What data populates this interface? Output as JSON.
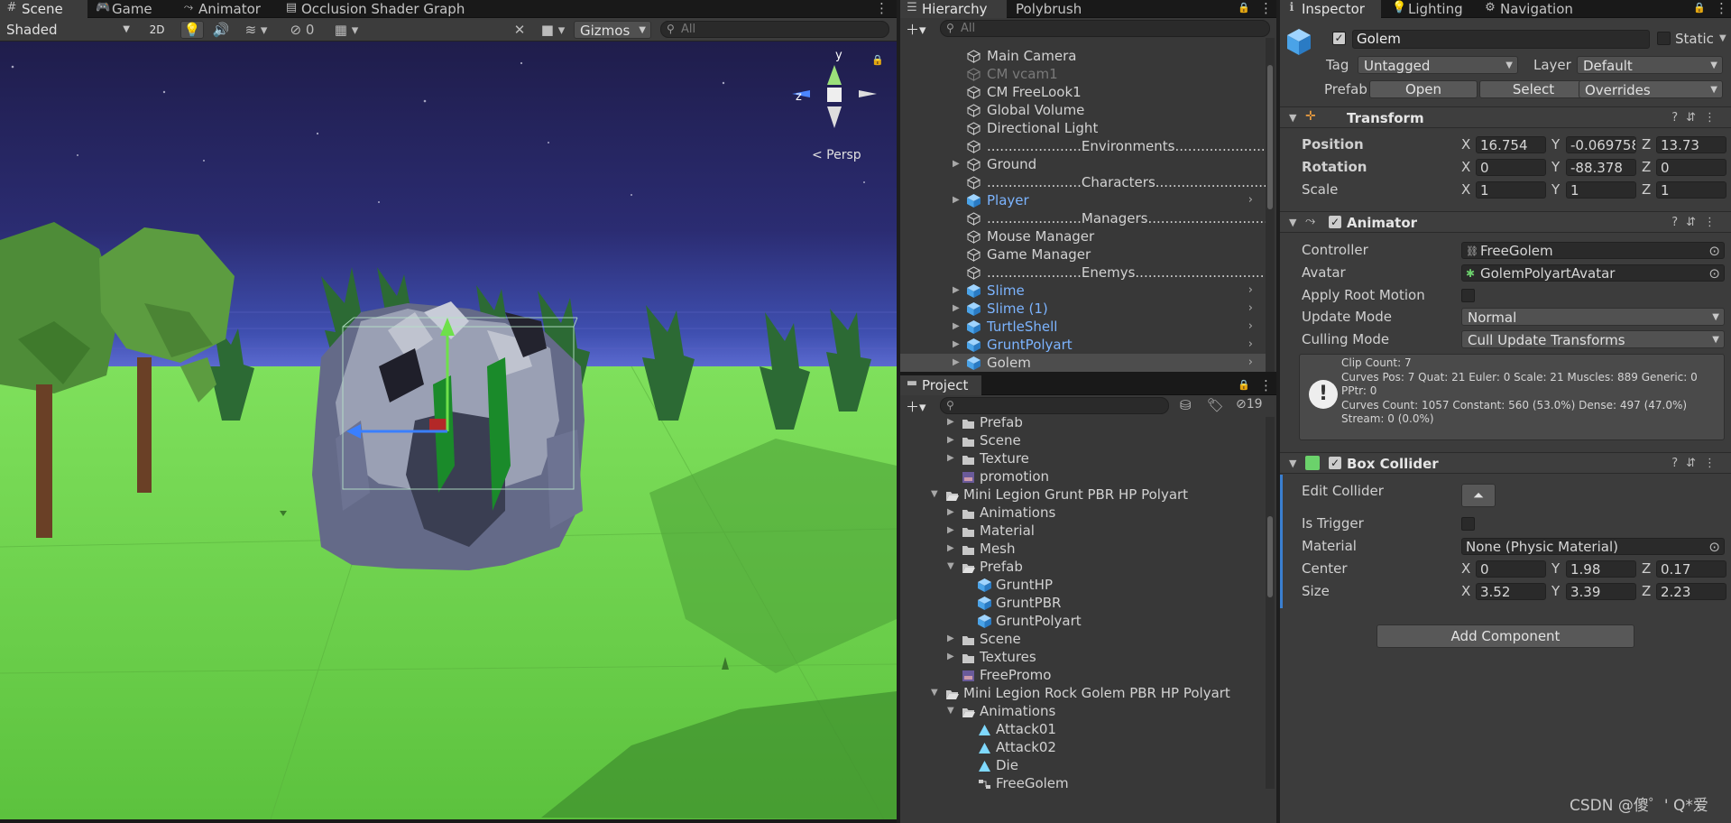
{
  "scene_panel": {
    "tabs": [
      {
        "label": "Scene",
        "icon": "hash-icon"
      },
      {
        "label": "Game",
        "icon": "gamepad-icon"
      },
      {
        "label": "Animator",
        "icon": "animator-icon"
      },
      {
        "label": "Occlusion Shader Graph",
        "icon": "shader-graph-icon"
      }
    ],
    "shading_mode": "Shaded",
    "mode_2d": "2D",
    "hidden_count": "0",
    "gizmos_label": "Gizmos",
    "search_placeholder": "All",
    "view_label": "< Persp",
    "axis_y": "y",
    "axis_z": "z"
  },
  "hierarchy": {
    "tabs": [
      "Hierarchy",
      "Polybrush"
    ],
    "search_placeholder": "All",
    "items": [
      {
        "label": "Main Camera",
        "style": "normal",
        "fold": "",
        "icon": "gameobject-icon"
      },
      {
        "label": "CM vcam1",
        "style": "dim",
        "fold": "",
        "icon": "gameobject-icon"
      },
      {
        "label": "CM FreeLook1",
        "style": "normal",
        "fold": "",
        "icon": "gameobject-icon"
      },
      {
        "label": "Global Volume",
        "style": "normal",
        "fold": "",
        "icon": "gameobject-icon"
      },
      {
        "label": "Directional Light",
        "style": "normal",
        "fold": "",
        "icon": "gameobject-icon"
      },
      {
        "label": "......................Environments..............................",
        "style": "normal",
        "fold": "",
        "icon": "gameobject-icon"
      },
      {
        "label": "Ground",
        "style": "normal",
        "fold": "▶",
        "icon": "gameobject-icon"
      },
      {
        "label": "......................Characters..............................",
        "style": "normal",
        "fold": "",
        "icon": "gameobject-icon"
      },
      {
        "label": "Player",
        "style": "prefab",
        "fold": "▶",
        "icon": "prefab-icon"
      },
      {
        "label": "......................Managers...............................",
        "style": "normal",
        "fold": "",
        "icon": "gameobject-icon"
      },
      {
        "label": "Mouse Manager",
        "style": "normal",
        "fold": "",
        "icon": "gameobject-icon"
      },
      {
        "label": "Game Manager",
        "style": "normal",
        "fold": "",
        "icon": "gameobject-icon"
      },
      {
        "label": "......................Enemys..............................",
        "style": "normal",
        "fold": "",
        "icon": "gameobject-icon"
      },
      {
        "label": "Slime",
        "style": "prefab",
        "fold": "▶",
        "icon": "prefab-icon"
      },
      {
        "label": "Slime (1)",
        "style": "prefab",
        "fold": "▶",
        "icon": "prefab-icon"
      },
      {
        "label": "TurtleShell",
        "style": "prefab",
        "fold": "▶",
        "icon": "prefab-icon"
      },
      {
        "label": "GruntPolyart",
        "style": "prefab",
        "fold": "▶",
        "icon": "prefab-icon"
      },
      {
        "label": "Golem",
        "style": "selected",
        "fold": "▶",
        "icon": "prefab-icon"
      }
    ]
  },
  "project": {
    "tab": "Project",
    "hidden_count": "19",
    "items": [
      {
        "label": "Prefab",
        "indent": 2,
        "fold": "▶",
        "icon": "folder-icon"
      },
      {
        "label": "Scene",
        "indent": 2,
        "fold": "▶",
        "icon": "folder-icon"
      },
      {
        "label": "Texture",
        "indent": 2,
        "fold": "▶",
        "icon": "folder-icon"
      },
      {
        "label": "promotion",
        "indent": 2,
        "fold": "",
        "icon": "image-icon"
      },
      {
        "label": "Mini Legion Grunt PBR HP Polyart",
        "indent": 1,
        "fold": "▼",
        "icon": "folder-open-icon"
      },
      {
        "label": "Animations",
        "indent": 2,
        "fold": "▶",
        "icon": "folder-icon"
      },
      {
        "label": "Material",
        "indent": 2,
        "fold": "▶",
        "icon": "folder-icon"
      },
      {
        "label": "Mesh",
        "indent": 2,
        "fold": "▶",
        "icon": "folder-icon"
      },
      {
        "label": "Prefab",
        "indent": 2,
        "fold": "▼",
        "icon": "folder-open-icon"
      },
      {
        "label": "GruntHP",
        "indent": 3,
        "fold": "",
        "icon": "prefab-icon"
      },
      {
        "label": "GruntPBR",
        "indent": 3,
        "fold": "",
        "icon": "prefab-icon"
      },
      {
        "label": "GruntPolyart",
        "indent": 3,
        "fold": "",
        "icon": "prefab-icon"
      },
      {
        "label": "Scene",
        "indent": 2,
        "fold": "▶",
        "icon": "folder-icon"
      },
      {
        "label": "Textures",
        "indent": 2,
        "fold": "▶",
        "icon": "folder-icon"
      },
      {
        "label": "FreePromo",
        "indent": 2,
        "fold": "",
        "icon": "image-icon"
      },
      {
        "label": "Mini Legion Rock Golem PBR HP Polyart",
        "indent": 1,
        "fold": "▼",
        "icon": "folder-open-icon"
      },
      {
        "label": "Animations",
        "indent": 2,
        "fold": "▼",
        "icon": "folder-open-icon"
      },
      {
        "label": "Attack01",
        "indent": 3,
        "fold": "",
        "icon": "anim-clip-icon"
      },
      {
        "label": "Attack02",
        "indent": 3,
        "fold": "",
        "icon": "anim-clip-icon"
      },
      {
        "label": "Die",
        "indent": 3,
        "fold": "",
        "icon": "anim-clip-icon"
      },
      {
        "label": "FreeGolem",
        "indent": 3,
        "fold": "",
        "icon": "animator-controller-icon"
      }
    ]
  },
  "inspector": {
    "tabs": [
      "Inspector",
      "Lighting",
      "Navigation"
    ],
    "object_name": "Golem",
    "static_label": "Static",
    "tag_label": "Tag",
    "tag_value": "Untagged",
    "layer_label": "Layer",
    "layer_value": "Default",
    "prefab_label": "Prefab",
    "open_label": "Open",
    "select_label": "Select",
    "overrides_label": "Overrides",
    "transform": {
      "title": "Transform",
      "position_label": "Position",
      "rotation_label": "Rotation",
      "scale_label": "Scale",
      "position": {
        "x": "16.754",
        "y": "-0.069758",
        "z": "13.73"
      },
      "rotation": {
        "x": "0",
        "y": "-88.378",
        "z": "0"
      },
      "scale": {
        "x": "1",
        "y": "1",
        "z": "1"
      }
    },
    "animator": {
      "title": "Animator",
      "controller_label": "Controller",
      "controller_value": "FreeGolem",
      "avatar_label": "Avatar",
      "avatar_value": "GolemPolyartAvatar",
      "apply_root_motion_label": "Apply Root Motion",
      "update_mode_label": "Update Mode",
      "update_mode_value": "Normal",
      "culling_mode_label": "Culling Mode",
      "culling_mode_value": "Cull Update Transforms",
      "info_lines": [
        "Clip Count: 7",
        "Curves Pos: 7 Quat: 21 Euler: 0 Scale: 21 Muscles: 889 Generic: 0",
        "PPtr: 0",
        "Curves Count: 1057 Constant: 560 (53.0%) Dense: 497 (47.0%)",
        "Stream: 0 (0.0%)"
      ]
    },
    "box_collider": {
      "title": "Box Collider",
      "edit_collider_label": "Edit Collider",
      "is_trigger_label": "Is Trigger",
      "material_label": "Material",
      "material_value": "None (Physic Material)",
      "center_label": "Center",
      "size_label": "Size",
      "center": {
        "x": "0",
        "y": "1.98",
        "z": "0.17"
      },
      "size": {
        "x": "3.52",
        "y": "3.39",
        "z": "2.23"
      }
    },
    "add_component_label": "Add Component"
  },
  "watermark": "CSDN @傻゜' Q*爱",
  "colors": {
    "accent": "#7cb4ff",
    "selection": "#4d4d4d",
    "panel": "#383838",
    "sky_top": "#1f1d4b",
    "grass": "#6ed24c"
  }
}
